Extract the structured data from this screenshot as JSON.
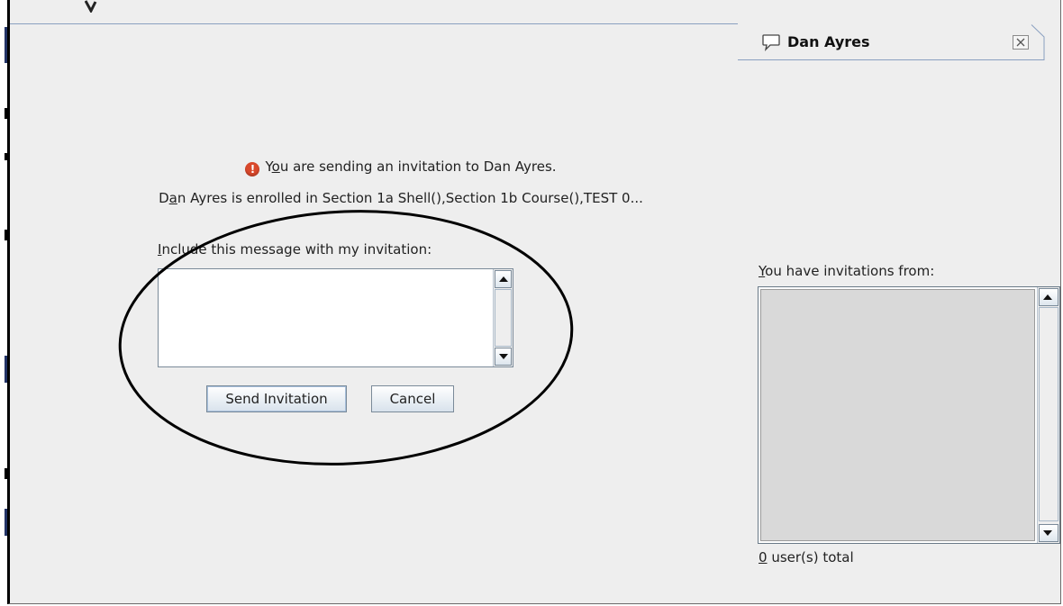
{
  "chat_tab": {
    "name": "Dan Ayres",
    "icon": "speech-bubble-icon",
    "close_icon": "close-icon"
  },
  "invitation": {
    "notice_icon": "warning-icon",
    "notice_mnemonic": "o",
    "notice_text_a": "Y",
    "notice_text_b": "u are sending an invitation to Dan Ayres.",
    "enrolled_a": "D",
    "enrolled_mnemonic": "a",
    "enrolled_b": "n Ayres is enrolled in Section 1a Shell(),Section 1b Course(),TEST 0...",
    "include_mnemonic": "I",
    "include_rest": "nclude this message with my invitation:",
    "message_value": "",
    "send_label": "Send Invitation",
    "cancel_label": "Cancel"
  },
  "invitations_panel": {
    "label_mnemonic": "Y",
    "label_rest": "ou have invitations from:",
    "count_mnemonic": "0",
    "count_rest": " user(s) total",
    "items": []
  },
  "colors": {
    "background": "#eeeeee",
    "accent_border": "#7a8a99",
    "warning": "#d9482b"
  }
}
